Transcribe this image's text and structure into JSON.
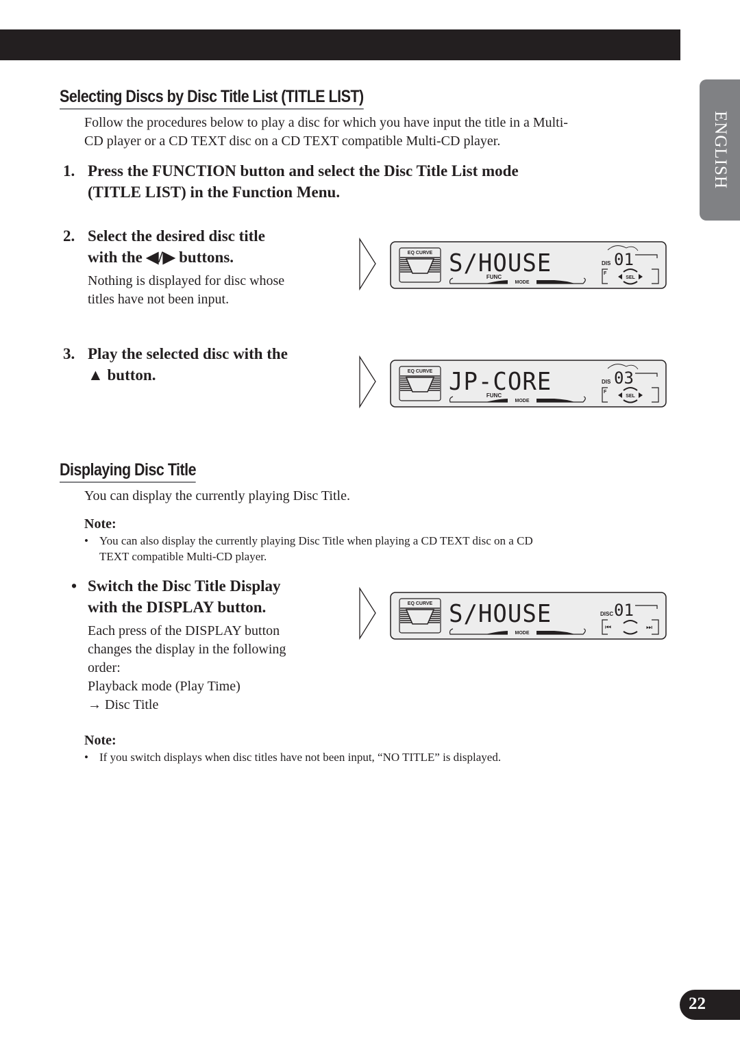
{
  "tab": {
    "language": "ENGLISH"
  },
  "section1": {
    "heading": "Selecting Discs by Disc Title List (TITLE LIST)",
    "intro_line1": "Follow the procedures below to play a disc for which you have input the title in a Multi-",
    "intro_line2": "CD player or a CD TEXT disc on a CD TEXT compatible Multi-CD player.",
    "steps": [
      {
        "num": "1.",
        "line1": "Press the FUNCTION button and select the Disc Title List mode",
        "line2": "(TITLE LIST) in the Function Menu."
      },
      {
        "num": "2.",
        "line1": "Select the desired disc title",
        "line2": "with the ◀/▶ buttons.",
        "desc1": "Nothing is displayed for disc whose",
        "desc2": "titles have not been input."
      },
      {
        "num": "3.",
        "line1": "Play the selected disc with the",
        "line2": "▲ button."
      }
    ]
  },
  "section2": {
    "heading": "Displaying Disc Title",
    "intro": "You can display the currently playing Disc Title.",
    "note1_title": "Note:",
    "note1_bullet": "•",
    "note1_line1": "You can also display the currently playing Disc Title when playing a CD TEXT disc on a CD",
    "note1_line2": "TEXT compatible Multi-CD player.",
    "bullet_step": {
      "bullet": "•",
      "line1": "Switch the Disc Title Display",
      "line2": "with the DISPLAY button.",
      "desc": [
        "Each press of the DISPLAY button",
        "changes the display in the following",
        "order:",
        "Playback mode (Play Time)",
        "→ Disc Title"
      ]
    },
    "note2_title": "Note:",
    "note2_bullet": "•",
    "note2_text": "If you switch displays when disc titles have not been input, “NO TITLE” is displayed."
  },
  "displays": [
    {
      "eq_label": "EQ CURVE",
      "title": "S/HOUSE",
      "disc_label": "DIS",
      "disc_num": "01",
      "func_label": "FUNC",
      "mode_label": "MODE",
      "f_label": "F",
      "sel_label": "SEL",
      "variant": "select"
    },
    {
      "eq_label": "EQ CURVE",
      "title": "JP-CORE",
      "disc_label": "DIS",
      "disc_num": "03",
      "func_label": "FUNC",
      "mode_label": "MODE",
      "f_label": "F",
      "sel_label": "SEL",
      "variant": "select"
    },
    {
      "eq_label": "EQ CURVE",
      "title": "S/HOUSE",
      "disc_label": "DISC",
      "disc_num": "01",
      "mode_label": "MODE",
      "variant": "track"
    }
  ],
  "page": {
    "number": "22"
  }
}
